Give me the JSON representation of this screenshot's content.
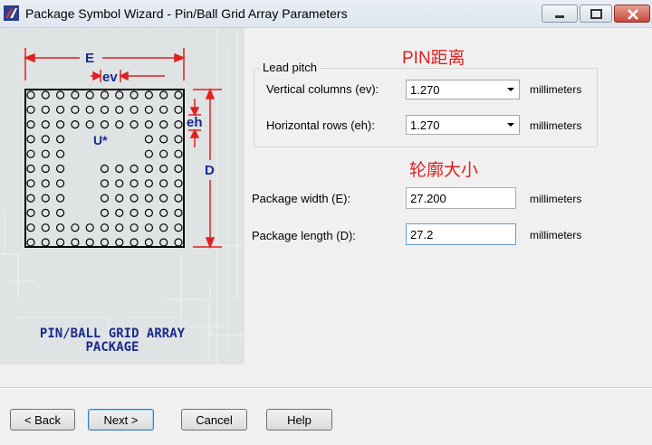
{
  "window": {
    "title": "Package Symbol Wizard - Pin/Ball Grid Array Parameters",
    "icons": {
      "app": "wizard-app-icon",
      "minimize": "minimize-icon",
      "maximize": "maximize-icon",
      "close": "close-icon"
    }
  },
  "graphic": {
    "label_e": "E",
    "label_ev": "ev",
    "label_eh": "eh",
    "label_d": "D",
    "label_u": "U*",
    "caption_line1": "PIN/BALL GRID ARRAY",
    "caption_line2": "PACKAGE"
  },
  "annotations": {
    "pin_distance": "PIN距离",
    "outline_size": "轮廓大小"
  },
  "lead_pitch": {
    "group_label": "Lead pitch",
    "vertical_label": "Vertical columns (ev):",
    "vertical_value": "1.270",
    "vertical_unit": "millimeters",
    "horizontal_label": "Horizontal rows (eh):",
    "horizontal_value": "1.270",
    "horizontal_unit": "millimeters"
  },
  "package": {
    "width_label": "Package width (E):",
    "width_value": "27.200",
    "width_unit": "millimeters",
    "length_label": "Package length (D):",
    "length_value": "27.2",
    "length_unit": "millimeters"
  },
  "buttons": {
    "back": "< Back",
    "next": "Next >",
    "cancel": "Cancel",
    "help": "Help"
  },
  "colors": {
    "caption": "#1a2a8c",
    "dimension_red": "#e02020",
    "annotation_red": "#e02020"
  }
}
